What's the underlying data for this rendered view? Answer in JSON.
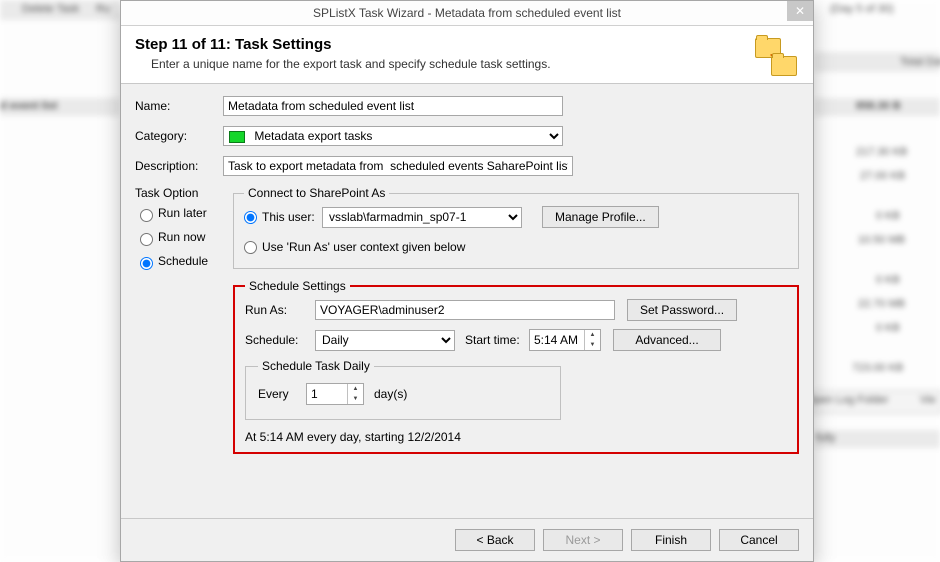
{
  "window": {
    "title": "SPListX Task Wizard - Metadata from scheduled event list"
  },
  "header": {
    "step_title": "Step 11 of 11: Task Settings",
    "subtitle": "Enter a unique name for the export task and specify schedule task settings."
  },
  "labels": {
    "name": "Name:",
    "category": "Category:",
    "description": "Description:",
    "task_option": "Task Option"
  },
  "fields": {
    "name": "Metadata from scheduled event list",
    "category": "Metadata export tasks",
    "description": "Task to export metadata from  scheduled events SaharePoint list"
  },
  "task_option": {
    "run_later": "Run later",
    "run_now": "Run now",
    "schedule": "Schedule",
    "selected": "schedule"
  },
  "connect": {
    "legend": "Connect to SharePoint As",
    "this_user_label": "This user:",
    "this_user_value": "vsslab\\farmadmin_sp07-1",
    "runas_label": "Use 'Run As' user context given below",
    "manage_profile": "Manage Profile..."
  },
  "schedule": {
    "legend": "Schedule Settings",
    "runas_label": "Run As:",
    "runas_value": "VOYAGER\\adminuser2",
    "set_password": "Set Password...",
    "schedule_label": "Schedule:",
    "schedule_value": "Daily",
    "start_label": "Start time:",
    "start_value": "5:14 AM",
    "advanced": "Advanced...",
    "daily_legend": "Schedule Task Daily",
    "every_label": "Every",
    "every_value": "1",
    "days_label": "day(s)",
    "summary": "At 5:14 AM every day, starting 12/2/2014"
  },
  "footer": {
    "back": "< Back",
    "next": "Next >",
    "finish": "Finish",
    "cancel": "Cancel"
  },
  "bg": {
    "delete_task": "Delete Task",
    "run": "Ru",
    "event_list": "d event list",
    "day": "(Day 5 of 30)",
    "total": "Total Dat",
    "s1": "858.30 B",
    "s2": "217.30 KB",
    "s3": "27.00 KB",
    "s4": "0 KB",
    "s5": "10.50 MB",
    "s6": "0 KB",
    "s7": "22.70 MB",
    "s8": "0 KB",
    "s9": "723.00 KB",
    "open_log": "Open Log Folder",
    "view": "Vie",
    "fully": "fully"
  }
}
